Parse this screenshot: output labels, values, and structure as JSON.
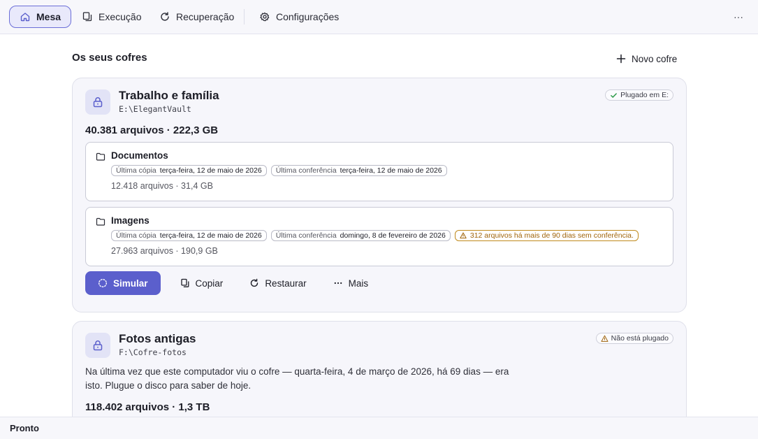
{
  "nav": {
    "items": [
      {
        "label": "Mesa",
        "icon": "home-icon",
        "active": true
      },
      {
        "label": "Execução",
        "icon": "copy-icon",
        "active": false
      },
      {
        "label": "Recuperação",
        "icon": "refresh-icon",
        "active": false
      },
      {
        "label": "Configurações",
        "icon": "gear-icon",
        "active": false
      }
    ],
    "more_label": "···"
  },
  "section": {
    "title": "Os seus cofres",
    "new_vault_label": "Novo cofre"
  },
  "vaults": [
    {
      "name": "Trabalho e família",
      "path": "E:\\ElegantVault",
      "status": "Plugado em E:",
      "status_kind": "ok",
      "total": "40.381 arquivos · 222,3 GB",
      "folders": [
        {
          "name": "Documentos",
          "last_copy_label": "Última cópia",
          "last_copy_value": "terça-feira, 12 de maio de 2026",
          "last_check_label": "Última conferência",
          "last_check_value": "terça-feira, 12 de maio de 2026",
          "meta": "12.418 arquivos · 31,4 GB"
        },
        {
          "name": "Imagens",
          "last_copy_label": "Última cópia",
          "last_copy_value": "terça-feira, 12 de maio de 2026",
          "last_check_label": "Última conferência",
          "last_check_value": "domingo, 8 de fevereiro de 2026",
          "warning": "312 arquivos há mais de 90 dias sem conferência.",
          "meta": "27.963 arquivos · 190,9 GB"
        }
      ],
      "actions": {
        "simulate": "Simular",
        "copy": "Copiar",
        "restore": "Restaurar",
        "more": "Mais"
      }
    },
    {
      "name": "Fotos antigas",
      "path": "F:\\Cofre-fotos",
      "status": "Não está plugado",
      "status_kind": "warning",
      "note": "Na última vez que este computador viu o cofre — quarta-feira, 4 de março de 2026, há 69 dias — era isto. Plugue o disco para saber de hoje.",
      "total": "118.402 arquivos · 1,3 TB"
    }
  ],
  "statusbar": {
    "text": "Pronto"
  },
  "colors": {
    "accent": "#5b5fcc",
    "warning": "#a0640b",
    "ok": "#2e9b4a"
  }
}
